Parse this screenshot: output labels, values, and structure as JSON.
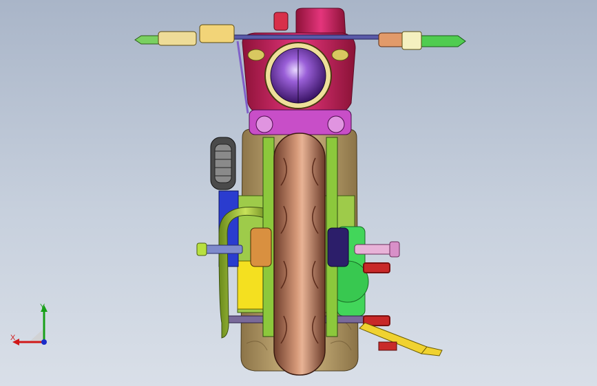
{
  "viewport": {
    "model": "motorcycle-front-view",
    "background_top": "#a9b5c8",
    "background_bottom": "#d9dfe8"
  },
  "triad": {
    "x_label": "X",
    "y_label": "Y",
    "x_color": "#d01818",
    "y_color": "#18a018",
    "z_color": "#1a2cc8"
  },
  "colors": {
    "tire": "#a86a50",
    "fuel_tank": "#d6246a",
    "headlight": "#7a2fb0",
    "triple_clamp": "#c040c8",
    "frame_green": "#8fcf3f",
    "rear_tire": "#c2a871"
  }
}
